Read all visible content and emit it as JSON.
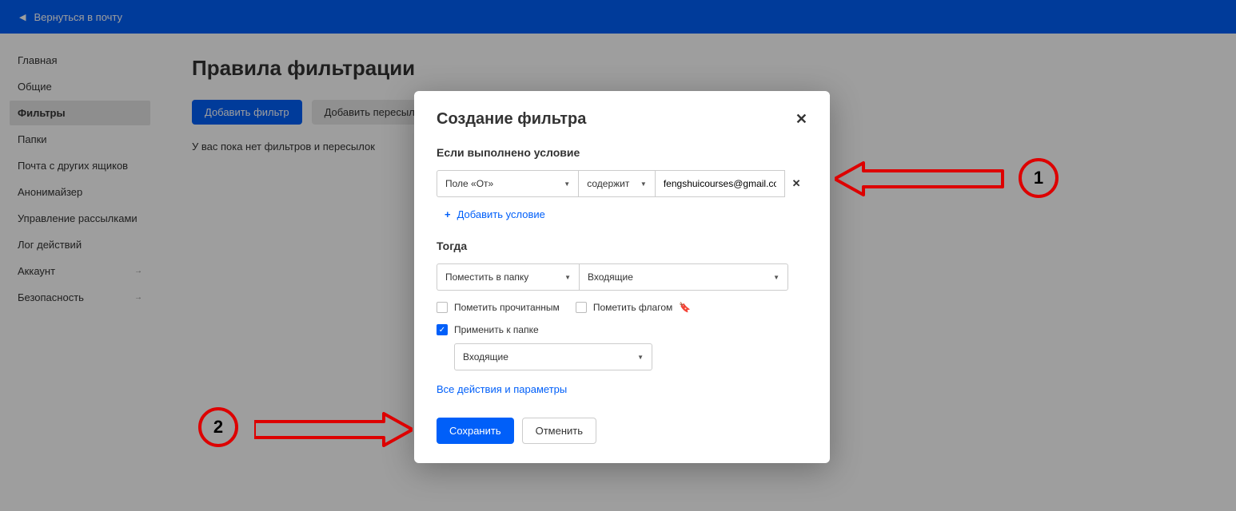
{
  "topbar": {
    "back_label": "Вернуться в почту"
  },
  "sidebar": {
    "items": [
      {
        "label": "Главная"
      },
      {
        "label": "Общие"
      },
      {
        "label": "Фильтры"
      },
      {
        "label": "Папки"
      },
      {
        "label": "Почта с других ящиков"
      },
      {
        "label": "Анонимайзер"
      },
      {
        "label": "Управление рассылками"
      },
      {
        "label": "Лог действий"
      },
      {
        "label": "Аккаунт"
      },
      {
        "label": "Безопасность"
      }
    ]
  },
  "main": {
    "title": "Правила фильтрации",
    "add_filter": "Добавить фильтр",
    "add_forward": "Добавить пересылку",
    "empty": "У вас пока нет фильтров и пересылок"
  },
  "modal": {
    "title": "Создание фильтра",
    "section_if": "Если выполнено условие",
    "field": "Поле «От»",
    "operator": "содержит",
    "value": "fengshuicourses@gmail.com",
    "add_condition": "Добавить условие",
    "section_then": "Тогда",
    "action": "Поместить в папку",
    "action_folder": "Входящие",
    "mark_read": "Пометить прочитанным",
    "mark_flag": "Пометить флагом",
    "apply_folder": "Применить к папке",
    "apply_folder_value": "Входящие",
    "all_actions": "Все действия и параметры",
    "save": "Сохранить",
    "cancel": "Отменить"
  },
  "annotations": {
    "n1": "1",
    "n2": "2"
  }
}
